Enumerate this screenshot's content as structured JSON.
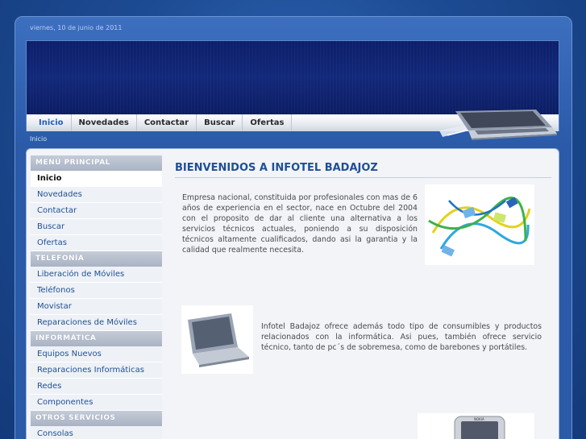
{
  "header": {
    "date": "viernes, 10 de junio de 2011"
  },
  "nav": {
    "items": [
      {
        "label": "Inicio",
        "active": true
      },
      {
        "label": "Novedades"
      },
      {
        "label": "Contactar"
      },
      {
        "label": "Buscar"
      },
      {
        "label": "Ofertas"
      }
    ]
  },
  "breadcrumb": "Inicio",
  "sidebar": {
    "sections": [
      {
        "heading": "MENÚ PRINCIPAL",
        "items": [
          "Inicio",
          "Novedades",
          "Contactar",
          "Buscar",
          "Ofertas"
        ]
      },
      {
        "heading": "TELEFONÍA",
        "items": [
          "Liberación de Móviles",
          "Teléfonos",
          "Movistar",
          "Reparaciones de Móviles"
        ]
      },
      {
        "heading": "INFORMÁTICA",
        "items": [
          "Equipos Nuevos",
          "Reparaciones Informáticas",
          "Redes",
          "Componentes"
        ]
      },
      {
        "heading": "OTROS SERVICIOS",
        "items": [
          "Consolas"
        ]
      }
    ]
  },
  "main": {
    "title": "BIENVENIDOS A INFOTEL BADAJOZ",
    "paragraph1": "Empresa nacional, constituida por profesionales con mas de 6 años de experiencia en el sector, nace en Octubre del 2004 con el proposito de dar al cliente una alternativa a los servicios técnicos actuales, poniendo a su disposición  técnicos altamente cualificados, dando asi la garantia y la calidad que realmente necesita.",
    "paragraph2": "Infotel Badajoz ofrece además todo tipo de consumibles y  productos relacionados con la informática. Asi pues, también ofrece servicio técnico, tanto de pc´s de sobremesa, como de barebones y portátiles.",
    "images": [
      "network-cables-photo",
      "tablet-laptop-photo",
      "mobile-phone-photo"
    ]
  },
  "colors": {
    "background": "#1d4b93",
    "banner": "#12287a",
    "accent": "#1f4f96",
    "nav_active": "#1a5fc4"
  }
}
